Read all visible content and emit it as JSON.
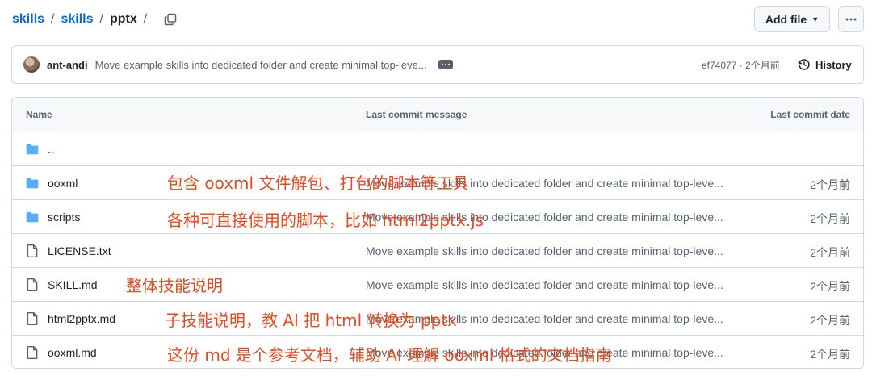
{
  "breadcrumb": {
    "items": [
      "skills",
      "skills"
    ],
    "current": "pptx",
    "separator": "/"
  },
  "header": {
    "add_file_label": "Add file"
  },
  "commit": {
    "author": "ant-andi",
    "message": "Move example skills into dedicated folder and create minimal top-leve...",
    "sha_time": "ef74077 · 2个月前",
    "history_label": "History"
  },
  "table": {
    "headers": {
      "name": "Name",
      "message": "Last commit message",
      "date": "Last commit date"
    },
    "rows": [
      {
        "type": "folder",
        "name": "..",
        "message": "",
        "date": ""
      },
      {
        "type": "folder",
        "name": "ooxml",
        "message": "Move example skills into dedicated folder and create minimal top-leve...",
        "date": "2个月前"
      },
      {
        "type": "folder",
        "name": "scripts",
        "message": "Move example skills into dedicated folder and create minimal top-leve...",
        "date": "2个月前"
      },
      {
        "type": "file",
        "name": "LICENSE.txt",
        "message": "Move example skills into dedicated folder and create minimal top-leve...",
        "date": "2个月前"
      },
      {
        "type": "file",
        "name": "SKILL.md",
        "message": "Move example skills into dedicated folder and create minimal top-leve...",
        "date": "2个月前"
      },
      {
        "type": "file",
        "name": "html2pptx.md",
        "message": "Move example skills into dedicated folder and create minimal top-leve...",
        "date": "2个月前"
      },
      {
        "type": "file",
        "name": "ooxml.md",
        "message": "Move example skills into dedicated folder and create minimal top-leve...",
        "date": "2个月前"
      }
    ]
  },
  "annotations": [
    "包含 ooxml 文件解包、打包的脚本等工具",
    "各种可直接使用的脚本，比如 html2pptx.js",
    "整体技能说明",
    "子技能说明，教 AI 把 html 转换为 pptx",
    "这份 md 是个参考文档，辅助 AI 理解 ooxml 格式的文档指南"
  ],
  "colors": {
    "link": "#0969da",
    "annotation": "#e8491d",
    "folder": "#54aeff",
    "muted": "#59636e"
  }
}
